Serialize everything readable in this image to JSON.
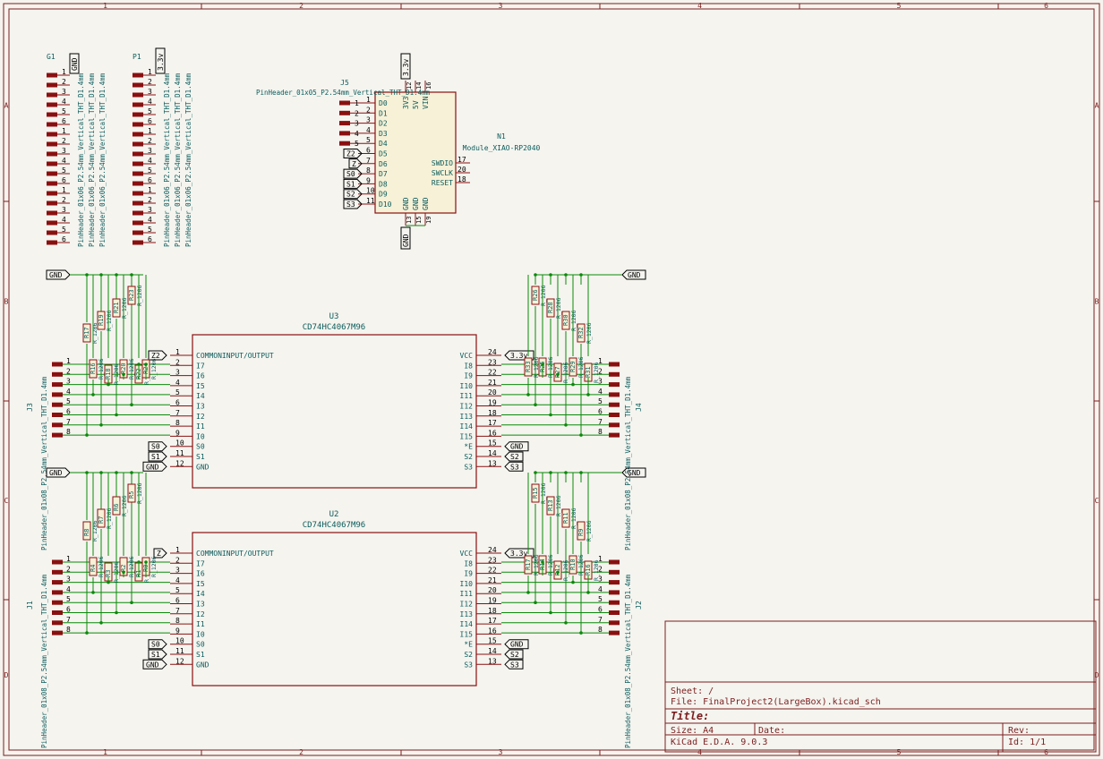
{
  "frame": {
    "columns": [
      "1",
      "2",
      "3",
      "4",
      "5",
      "6"
    ],
    "rows": [
      "A",
      "B",
      "C",
      "D"
    ],
    "colors": {
      "frame": "#7a1e1e",
      "wire": "#0a8a0a",
      "text": "#0b5c5c",
      "pin": "#8a1010",
      "body": "#f7f1d7"
    }
  },
  "title_block": {
    "sheet": "Sheet: /",
    "file": "File: FinalProject2(LargeBox).kicad_sch",
    "title": "Title:",
    "size": "Size: A4",
    "date": "Date:",
    "rev": "Rev:",
    "tool": "KiCad E.D.A. 9.0.3",
    "id": "Id: 1/1"
  },
  "headers_top": {
    "g1": {
      "ref": "G1",
      "value": "PinHeader_01x06_P2.54mm_Vertical_THT_D1.4mm",
      "pins": [
        "1",
        "2",
        "3",
        "4",
        "5",
        "6"
      ]
    },
    "p1": {
      "ref": "P1",
      "value": "PinHeader_01x06_P2.54mm_Vertical_THT_D1.4mm",
      "pins": [
        "1",
        "2",
        "3",
        "4",
        "5",
        "6"
      ]
    },
    "g1_label": "GND",
    "p1_label": "3.3v"
  },
  "module": {
    "ref": "N1",
    "value": "Module_XIAO-RP2040",
    "header_ref": "J5",
    "header_value": "PinHeader_01x05_P2.54mm_Vertical_THT_D1.4mm",
    "header_pins": [
      "1",
      "2",
      "3",
      "4",
      "5"
    ],
    "left_pins": [
      {
        "name": "D0",
        "num": "1"
      },
      {
        "name": "D1",
        "num": "2"
      },
      {
        "name": "D2",
        "num": "3"
      },
      {
        "name": "D3",
        "num": "4"
      },
      {
        "name": "D4",
        "num": "5"
      },
      {
        "name": "D5",
        "num": "6"
      },
      {
        "name": "D6",
        "num": "7"
      },
      {
        "name": "D7",
        "num": "8"
      },
      {
        "name": "D8",
        "num": "9"
      },
      {
        "name": "D9",
        "num": "10"
      },
      {
        "name": "D10",
        "num": "11"
      }
    ],
    "left_labels": [
      "Z2",
      "Z",
      "S0",
      "S1",
      "S2",
      "S3"
    ],
    "top_pins": [
      {
        "name": "3V3",
        "num": "12"
      },
      {
        "name": "5V",
        "num": "14"
      },
      {
        "name": "VIN",
        "num": "16"
      }
    ],
    "bottom_pins": [
      {
        "name": "GND",
        "num": "13"
      },
      {
        "name": "GND",
        "num": "15"
      },
      {
        "name": "GND",
        "num": "19"
      }
    ],
    "right_pins": [
      {
        "name": "SWDIO",
        "num": "17"
      },
      {
        "name": "SWCLK",
        "num": "20"
      },
      {
        "name": "RESET",
        "num": "18"
      }
    ],
    "power_top": "3.3v",
    "power_bottom": "GND"
  },
  "mux": [
    {
      "ref": "U3",
      "value": "CD74HC4067M96",
      "left_pins": [
        {
          "name": "COMMONINPUT/OUTPUT",
          "num": "1"
        },
        {
          "name": "I7",
          "num": "2"
        },
        {
          "name": "I6",
          "num": "3"
        },
        {
          "name": "I5",
          "num": "4"
        },
        {
          "name": "I4",
          "num": "5"
        },
        {
          "name": "I3",
          "num": "6"
        },
        {
          "name": "I2",
          "num": "7"
        },
        {
          "name": "I1",
          "num": "8"
        },
        {
          "name": "I0",
          "num": "9"
        },
        {
          "name": "S0",
          "num": "10"
        },
        {
          "name": "S1",
          "num": "11"
        },
        {
          "name": "GND",
          "num": "12"
        }
      ],
      "right_pins": [
        {
          "name": "VCC",
          "num": "24"
        },
        {
          "name": "I8",
          "num": "23"
        },
        {
          "name": "I9",
          "num": "22"
        },
        {
          "name": "I10",
          "num": "21"
        },
        {
          "name": "I11",
          "num": "20"
        },
        {
          "name": "I12",
          "num": "19"
        },
        {
          "name": "I13",
          "num": "18"
        },
        {
          "name": "I14",
          "num": "17"
        },
        {
          "name": "I15",
          "num": "16"
        },
        {
          "name": "*E",
          "num": "15"
        },
        {
          "name": "S2",
          "num": "14"
        },
        {
          "name": "S3",
          "num": "13"
        }
      ],
      "common_label": "Z2",
      "vcc_label": "3.3v",
      "left_header": {
        "ref": "J3",
        "value": "PinHeader_01x08_P2.54mm_Vertical_THT_D1.4mm"
      },
      "right_header": {
        "ref": "J4",
        "value": "PinHeader_01x08_P2.54mm_Vertical_THT_D1.4mm"
      },
      "left_resistors": [
        "R17",
        "R19",
        "R21",
        "R23",
        "R16",
        "R18",
        "R20",
        "R22",
        "R24"
      ],
      "right_resistors": [
        "R26",
        "R28",
        "R30",
        "R32",
        "R25",
        "R27",
        "R29",
        "R31",
        "R33"
      ],
      "res_value": "R_1206"
    },
    {
      "ref": "U2",
      "value": "CD74HC4067M96",
      "left_pins": [
        {
          "name": "COMMONINPUT/OUTPUT",
          "num": "1"
        },
        {
          "name": "I7",
          "num": "2"
        },
        {
          "name": "I6",
          "num": "3"
        },
        {
          "name": "I5",
          "num": "4"
        },
        {
          "name": "I4",
          "num": "5"
        },
        {
          "name": "I3",
          "num": "6"
        },
        {
          "name": "I2",
          "num": "7"
        },
        {
          "name": "I1",
          "num": "8"
        },
        {
          "name": "I0",
          "num": "9"
        },
        {
          "name": "S0",
          "num": "10"
        },
        {
          "name": "S1",
          "num": "11"
        },
        {
          "name": "GND",
          "num": "12"
        }
      ],
      "right_pins": [
        {
          "name": "VCC",
          "num": "24"
        },
        {
          "name": "I8",
          "num": "23"
        },
        {
          "name": "I9",
          "num": "22"
        },
        {
          "name": "I10",
          "num": "21"
        },
        {
          "name": "I11",
          "num": "20"
        },
        {
          "name": "I12",
          "num": "19"
        },
        {
          "name": "I13",
          "num": "18"
        },
        {
          "name": "I14",
          "num": "17"
        },
        {
          "name": "I15",
          "num": "16"
        },
        {
          "name": "*E",
          "num": "15"
        },
        {
          "name": "S2",
          "num": "14"
        },
        {
          "name": "S3",
          "num": "13"
        }
      ],
      "common_label": "Z",
      "vcc_label": "3.3v",
      "left_header": {
        "ref": "J1",
        "value": "PinHeader_01x08_P2.54mm_Vertical_THT_D1.4mm"
      },
      "right_header": {
        "ref": "J2",
        "value": "PinHeader_01x08_P2.54mm_Vertical_THT_D1.4mm"
      },
      "left_resistors": [
        "R8",
        "R7",
        "R6",
        "R5",
        "R4",
        "R3",
        "R2",
        "R1",
        "R0"
      ],
      "right_resistors": [
        "R15",
        "R13",
        "R11",
        "R9",
        "R14",
        "R12",
        "R10",
        "R16",
        "R17"
      ],
      "res_value": "R_1206"
    }
  ],
  "header_pins_8": [
    "1",
    "2",
    "3",
    "4",
    "5",
    "6",
    "7",
    "8"
  ],
  "labels": {
    "gnd": "GND",
    "s0": "S0",
    "s1": "S1",
    "s2": "S2",
    "s3": "S3"
  }
}
